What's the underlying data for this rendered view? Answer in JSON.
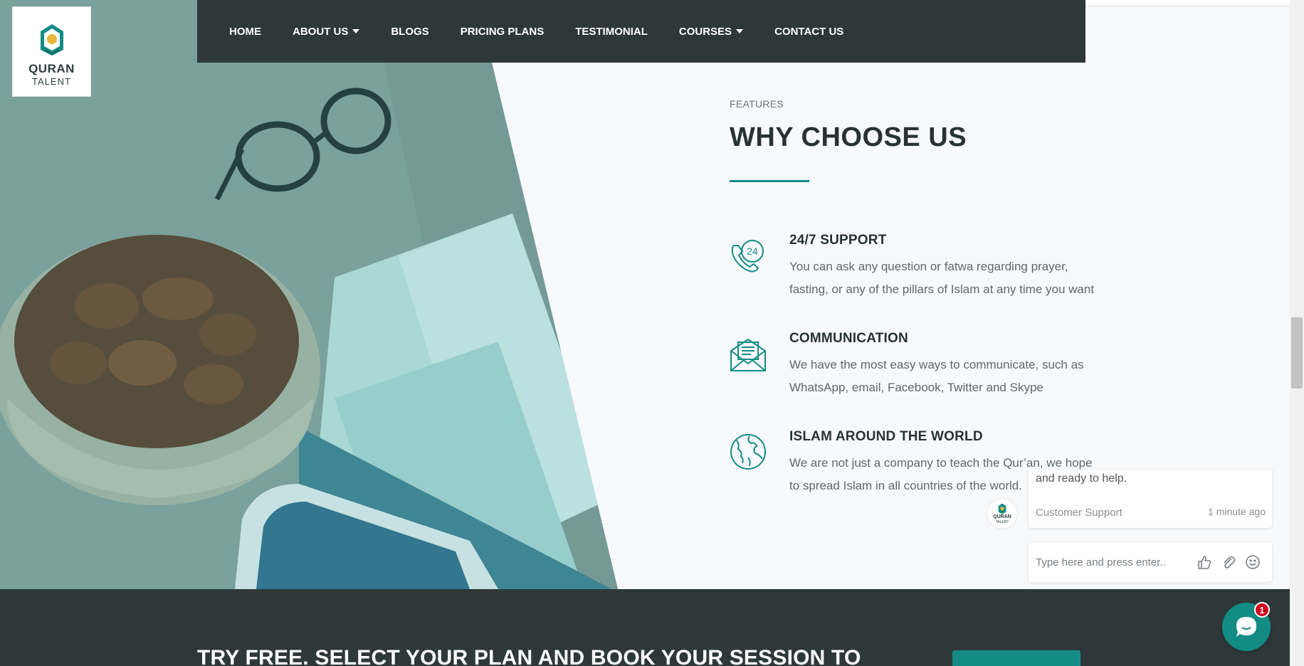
{
  "nav": {
    "items": [
      {
        "label": "HOME",
        "dropdown": false
      },
      {
        "label": "ABOUT US",
        "dropdown": true
      },
      {
        "label": "BLOGS",
        "dropdown": false
      },
      {
        "label": "PRICING PLANS",
        "dropdown": false
      },
      {
        "label": "TESTIMONIAL",
        "dropdown": false
      },
      {
        "label": "COURSES",
        "dropdown": true
      },
      {
        "label": "CONTACT US",
        "dropdown": false
      }
    ]
  },
  "logo": {
    "word": "QURAN",
    "sub": "TALENT"
  },
  "features": {
    "eyebrow": "FEATURES",
    "title": "WHY CHOOSE US",
    "items": [
      {
        "icon": "phone-24-icon",
        "title": "24/7 SUPPORT",
        "desc": "You can ask any question or fatwa regarding prayer, fasting, or any of the pillars of Islam at any time you want"
      },
      {
        "icon": "envelope-icon",
        "title": "COMMUNICATION",
        "desc": "We have the most easy ways to communicate, such as WhatsApp, email, Facebook, Twitter and Skype"
      },
      {
        "icon": "globe-icon",
        "title": "ISLAM AROUND THE WORLD",
        "desc": "We are not just a company to teach the Qur’an, we hope to spread Islam in all countries of the world."
      }
    ]
  },
  "chat": {
    "message": "and ready to help.",
    "agent": "Customer Support",
    "time": "1 minute ago",
    "input_placeholder": "Type here and press enter..",
    "avatar_word": "QURAN",
    "avatar_sub": "TALENT",
    "unread_count": "1"
  },
  "cta": {
    "text": "TRY FREE. SELECT YOUR PLAN AND BOOK YOUR SESSION TO"
  },
  "colors": {
    "accent": "#148c86",
    "nav_bg": "#2e3838",
    "badge": "#d0021b"
  }
}
